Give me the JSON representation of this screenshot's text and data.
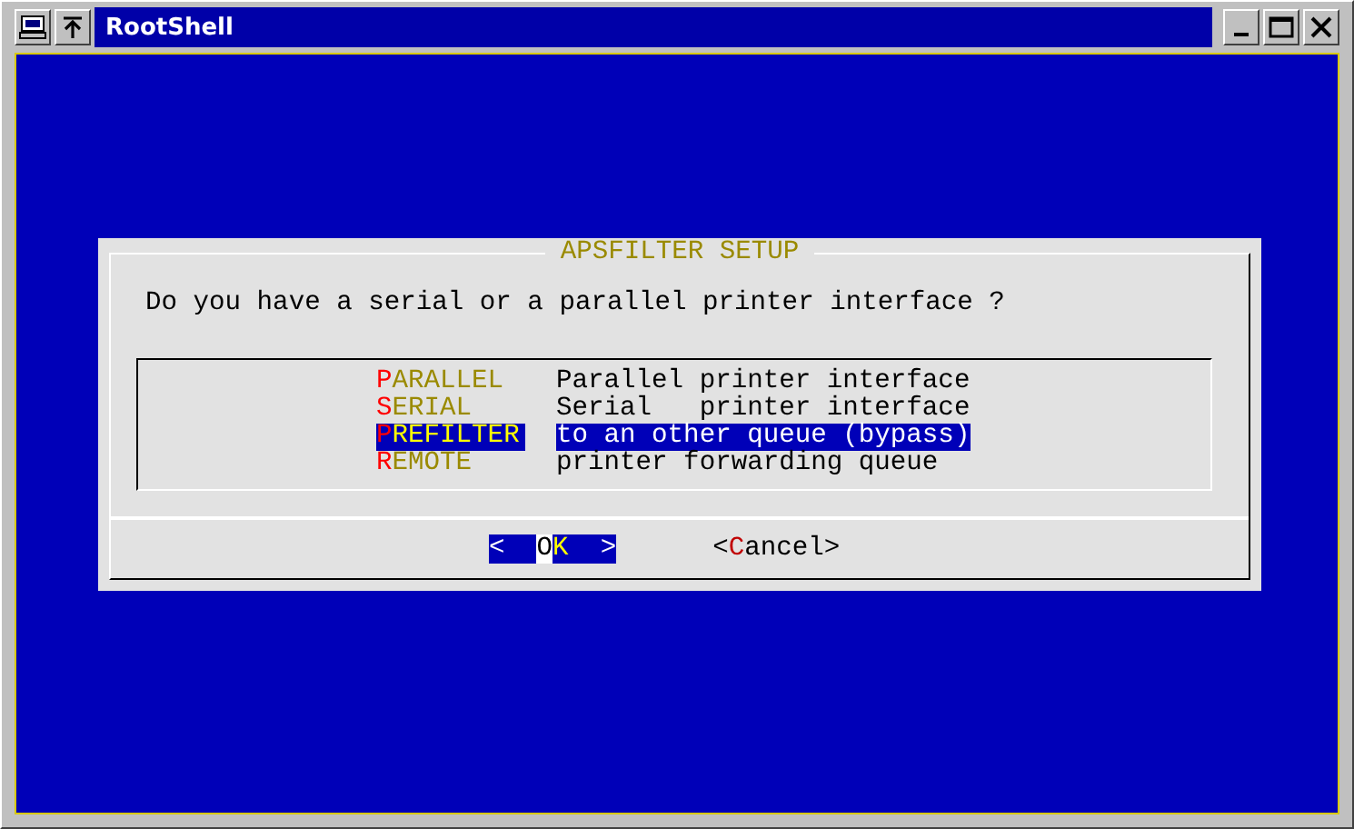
{
  "window": {
    "title": "RootShell"
  },
  "dialog": {
    "title": "APSFILTER SETUP",
    "prompt": "Do you have a serial or a parallel printer interface ?",
    "menu": [
      {
        "tag": [
          {
            "text": "P",
            "kind": "hotkey"
          },
          {
            "text": "ARALLEL",
            "kind": "plain"
          }
        ],
        "description": "Parallel printer interface",
        "selected": false
      },
      {
        "tag": [
          {
            "text": "S",
            "kind": "hotkey"
          },
          {
            "text": "ERIAL",
            "kind": "plain"
          }
        ],
        "description": "Serial   printer interface",
        "selected": false
      },
      {
        "tag": [
          {
            "text": "P",
            "kind": "hotkey"
          },
          {
            "text": "REFILTER",
            "kind": "plain"
          }
        ],
        "description": "to an other queue (bypass)",
        "selected": true
      },
      {
        "tag": [
          {
            "text": "R",
            "kind": "hotkey"
          },
          {
            "text": "EMOTE",
            "kind": "plain"
          }
        ],
        "description": "printer forwarding queue",
        "selected": false
      }
    ],
    "buttons": [
      {
        "parts": [
          {
            "text": "<  ",
            "kind": "plain"
          },
          {
            "text": "O",
            "kind": "cursor"
          },
          {
            "text": "K",
            "kind": "hotkey"
          },
          {
            "text": "  >",
            "kind": "plain"
          }
        ],
        "selected": true
      },
      {
        "parts": [
          {
            "text": "<",
            "kind": "plain"
          },
          {
            "text": "C",
            "kind": "hotkey"
          },
          {
            "text": "ancel>",
            "kind": "plain"
          }
        ],
        "selected": false
      }
    ]
  }
}
